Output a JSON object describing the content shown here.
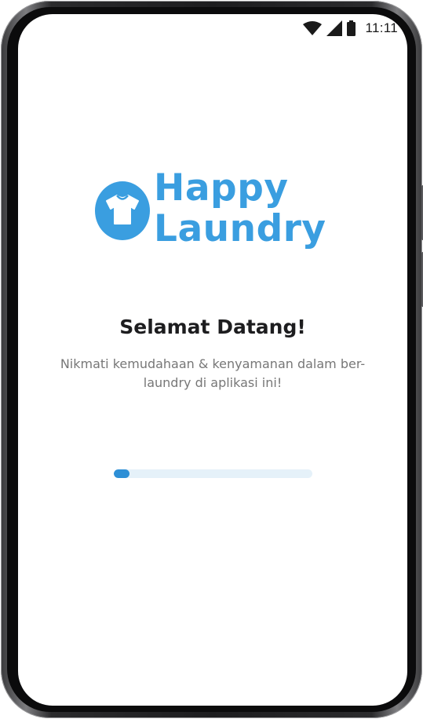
{
  "status_bar": {
    "time": "11:11",
    "icons": [
      "wifi-icon",
      "cellular-signal-icon",
      "battery-icon"
    ]
  },
  "app": {
    "logo": {
      "line1": "Happy",
      "line2": "Laundry",
      "icon": "tshirt-icon"
    },
    "welcome_title": "Selamat Datang!",
    "welcome_subtitle": "Nikmati kemudahaan & kenyamanan dalam ber-laundry di aplikasi ini!",
    "loading_progress": 0.08
  },
  "colors": {
    "brand": "#3a9ee0",
    "progress_fill": "#2d8fd6",
    "progress_track": "#e5f1f9",
    "title": "#1d1d1f",
    "subtitle": "#777777"
  }
}
